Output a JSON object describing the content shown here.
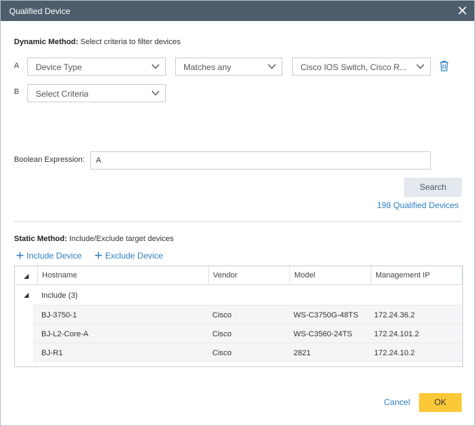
{
  "dialog": {
    "title": "Qualified Device",
    "close_icon": "close-icon"
  },
  "dynamic": {
    "label_bold": "Dynamic Method:",
    "label_rest": " Select criteria to filter devices",
    "criteria": [
      {
        "letter": "A",
        "field": "Device Type",
        "operator": "Matches any",
        "value": "Cisco IOS Switch, Cisco R..."
      },
      {
        "letter": "B",
        "field": "Select Criteria"
      }
    ],
    "delete_icon": "trash-icon",
    "boolean_label": "Boolean Expression:",
    "boolean_value": "A",
    "search_label": "Search",
    "qualified_text": "198 Qualified Devices"
  },
  "static": {
    "label_bold": "Static Method:",
    "label_rest": " Include/Exclude target devices",
    "include_label": "Include Device",
    "exclude_label": "Exclude Device",
    "columns": [
      "Hostname",
      "Vendor",
      "Model",
      "Management IP"
    ],
    "group_label": "Include (3)",
    "rows": [
      {
        "hostname": "BJ-3750-1",
        "vendor": "Cisco",
        "model": "WS-C3750G-48TS",
        "ip": "172.24.36.2"
      },
      {
        "hostname": "BJ-L2-Core-A",
        "vendor": "Cisco",
        "model": "WS-C3560-24TS",
        "ip": "172.24.101.2"
      },
      {
        "hostname": "BJ-R1",
        "vendor": "Cisco",
        "model": "2821",
        "ip": "172.24.10.2"
      }
    ]
  },
  "footer": {
    "cancel_label": "Cancel",
    "ok_label": "OK"
  },
  "colors": {
    "titlebar": "#4e5d6c",
    "link": "#2d7fc1",
    "ok_button": "#fcc838",
    "search_button": "#e4e9ef"
  }
}
